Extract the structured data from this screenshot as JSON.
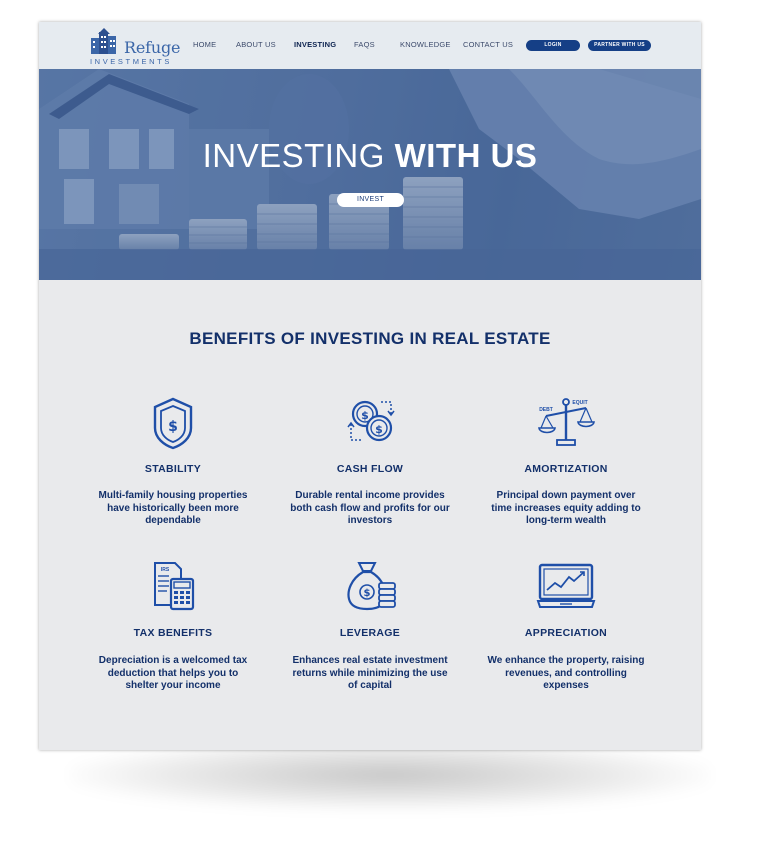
{
  "brand": {
    "name": "Refuge",
    "subtitle": "INVESTMENTS"
  },
  "nav": {
    "items": [
      "HOME",
      "ABOUT US",
      "INVESTING",
      "FAQS",
      "KNOWLEDGE",
      "CONTACT US"
    ],
    "active": "INVESTING",
    "login_label": "LOGIN",
    "partner_label": "PARTNER WITH US"
  },
  "hero": {
    "title_thin": "INVESTING",
    "title_bold": "WITH US",
    "button_label": "INVEST"
  },
  "benefits": {
    "title": "BENEFITS OF INVESTING IN REAL ESTATE",
    "items": [
      {
        "icon": "shield-dollar-icon",
        "title": "STABILITY",
        "desc": [
          "Multi-family housing properties",
          "have historically been more",
          "dependable"
        ]
      },
      {
        "icon": "cash-flow-coins-icon",
        "title": "CASH FLOW",
        "desc": [
          "Durable rental income provides",
          "both cash flow and profits for our",
          "investors"
        ]
      },
      {
        "icon": "debt-equity-scale-icon",
        "title": "AMORTIZATION",
        "desc": [
          "Principal down payment over",
          "time increases equity adding to",
          "long-term wealth"
        ],
        "scale_labels": [
          "DEBT",
          "EQUIT"
        ]
      },
      {
        "icon": "tax-calculator-icon",
        "title": "TAX BENEFITS",
        "desc": [
          "Depreciation is a welcomed tax",
          "deduction that helps you to",
          "shelter your income"
        ],
        "form_label": "IRS"
      },
      {
        "icon": "money-bag-coins-icon",
        "title": "LEVERAGE",
        "desc": [
          "Enhances real estate investment",
          "returns while minimizing the use",
          "of capital"
        ]
      },
      {
        "icon": "laptop-chart-icon",
        "title": "APPRECIATION",
        "desc": [
          "We enhance the property, raising",
          "revenues, and controlling",
          "expenses"
        ]
      }
    ]
  },
  "colors": {
    "navy": "#13306a",
    "button": "#153f86",
    "page_bg": "#e9eaec",
    "header_bg": "#e6ebf0",
    "hero_tint": "#5b77a3"
  }
}
